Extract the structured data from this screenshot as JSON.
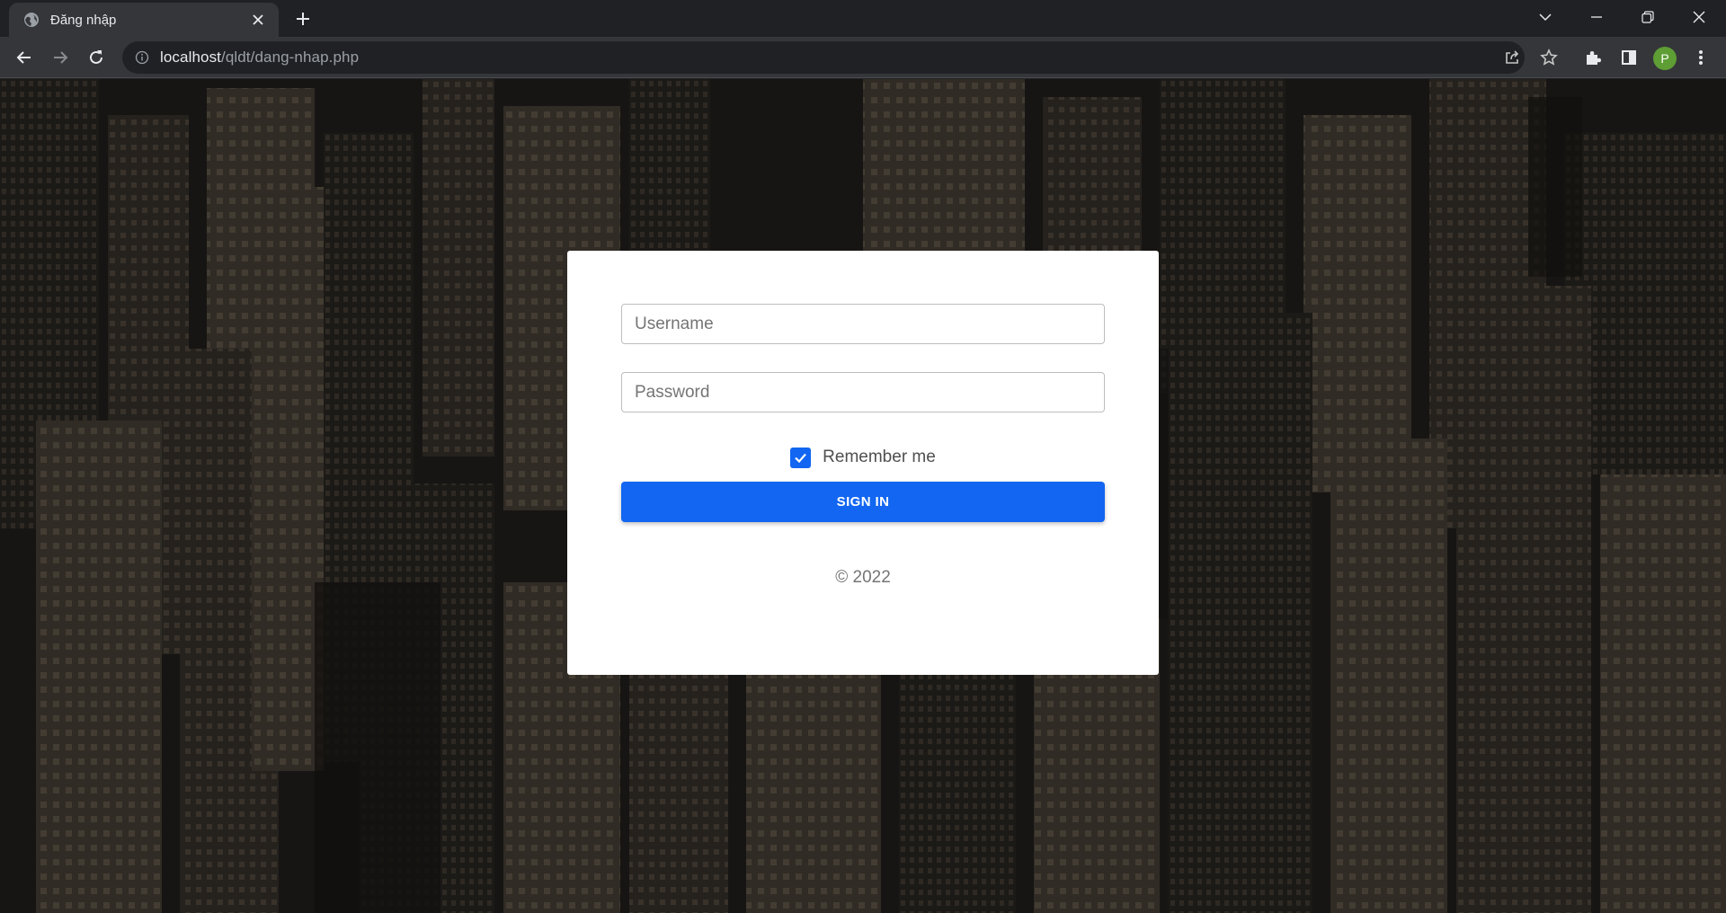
{
  "browser": {
    "tab_title": "Đăng nhập",
    "url_host": "localhost",
    "url_path": "/qldt/dang-nhap.php",
    "profile_initial": "P",
    "icons": {
      "favicon": "globe-icon",
      "close": "close-icon",
      "new_tab": "plus-icon",
      "tab_search": "chevron-down-icon",
      "minimize": "minimize-icon",
      "restore": "restore-icon",
      "window_close": "close-icon",
      "back": "back-arrow-icon",
      "forward": "forward-arrow-icon",
      "reload": "reload-icon",
      "site_info": "info-icon",
      "share": "share-icon",
      "bookmark": "star-icon",
      "extensions": "puzzle-icon",
      "side_panel": "side-panel-icon",
      "menu": "kebab-menu-icon"
    }
  },
  "login": {
    "username_placeholder": "Username",
    "password_placeholder": "Password",
    "remember_label": "Remember me",
    "remember_checked": true,
    "signin_label": "SIGN IN",
    "copyright": "© 2022"
  },
  "colors": {
    "primary": "#1266f1",
    "chrome_dark": "#202124",
    "chrome_toolbar": "#35363a",
    "avatar": "#5e9e34"
  }
}
